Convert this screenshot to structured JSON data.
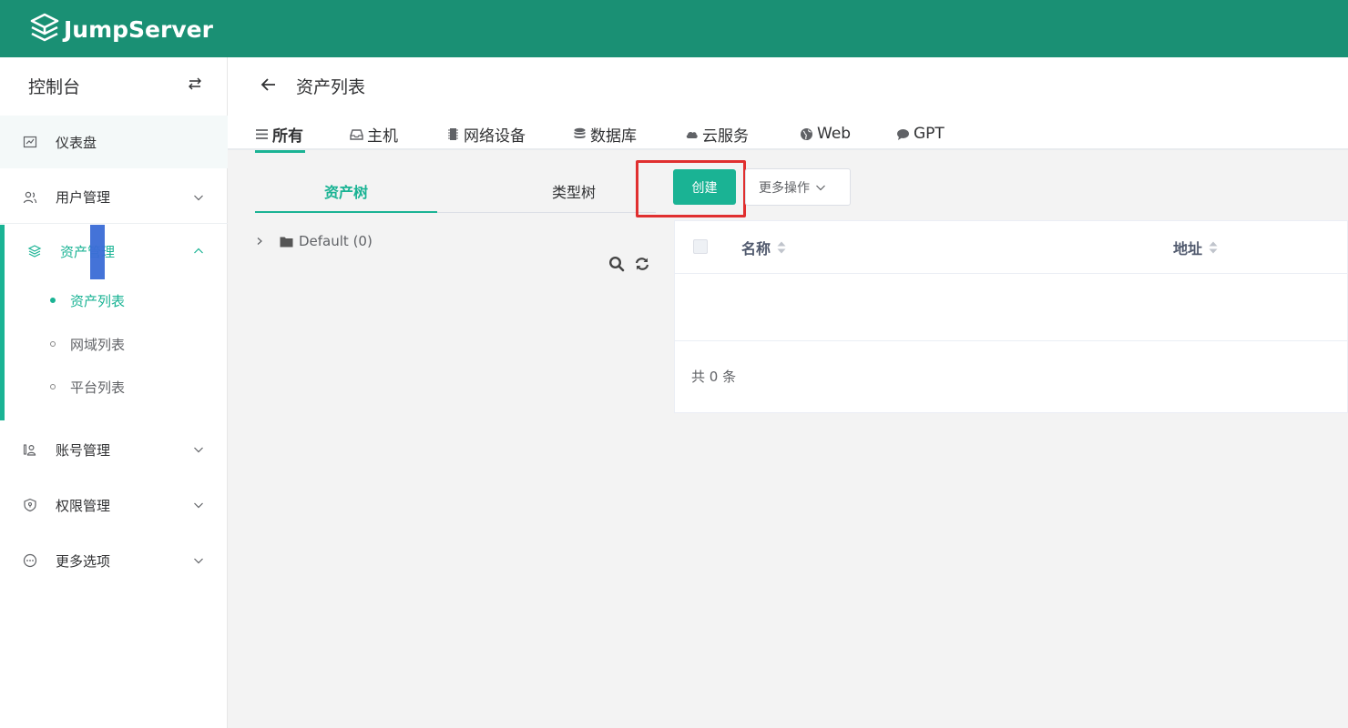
{
  "app": {
    "logo_text": "JumpServer"
  },
  "sidebar": {
    "title": "控制台",
    "items": [
      {
        "label": "仪表盘",
        "icon": "dashboard-icon"
      },
      {
        "label": "用户管理",
        "icon": "users-icon"
      },
      {
        "label": "资产管理",
        "icon": "layers-icon",
        "expanded": true
      },
      {
        "label": "账号管理",
        "icon": "account-icon"
      },
      {
        "label": "权限管理",
        "icon": "shield-icon"
      },
      {
        "label": "更多选项",
        "icon": "more-icon"
      }
    ],
    "sub_items": [
      {
        "label": "资产列表",
        "active": true
      },
      {
        "label": "网域列表"
      },
      {
        "label": "平台列表"
      }
    ]
  },
  "page": {
    "title": "资产列表",
    "tabs": [
      {
        "label": "所有",
        "icon": "list-icon",
        "active": true
      },
      {
        "label": "主机",
        "icon": "host-icon"
      },
      {
        "label": "网络设备",
        "icon": "network-device-icon"
      },
      {
        "label": "数据库",
        "icon": "database-icon"
      },
      {
        "label": "云服务",
        "icon": "cloud-icon"
      },
      {
        "label": "Web",
        "icon": "globe-icon"
      },
      {
        "label": "GPT",
        "icon": "chat-icon"
      }
    ]
  },
  "tree": {
    "tabs": [
      {
        "label": "资产树",
        "active": true
      },
      {
        "label": "类型树"
      }
    ],
    "nodes": [
      {
        "label": "Default (0)"
      }
    ]
  },
  "actions": {
    "create_label": "创建",
    "more_label": "更多操作"
  },
  "table": {
    "columns": [
      "名称",
      "地址"
    ],
    "rows": [],
    "footer": "共 0 条"
  },
  "colors": {
    "header_bg": "#1a9074",
    "accent": "#1ab394",
    "highlight": "#e02f2f"
  }
}
